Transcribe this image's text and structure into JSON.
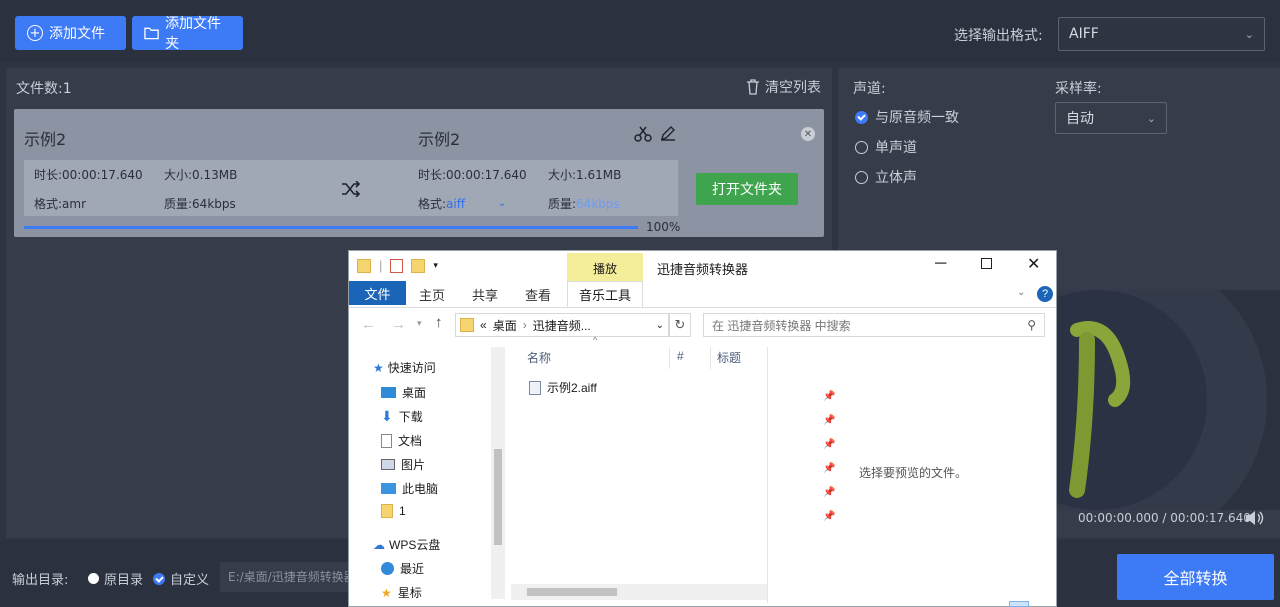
{
  "toolbar": {
    "add_file": "添加文件",
    "add_folder": "添加文件夹",
    "format_label": "选择输出格式:",
    "format_value": "AIFF"
  },
  "list": {
    "count_label": "文件数:",
    "count": "1",
    "clear": "清空列表"
  },
  "item": {
    "src_name": "示例2",
    "dst_name": "示例2",
    "src_duration": "时长:00:00:17.640",
    "src_size": "大小:0.13MB",
    "src_format": "格式:amr",
    "src_quality": "质量:64kbps",
    "dst_duration": "时长:00:00:17.640",
    "dst_size": "大小:1.61MB",
    "dst_format_label": "格式:",
    "dst_format": "aiff",
    "dst_quality_label": "质量:",
    "dst_quality": "64kbps",
    "open_folder": "打开文件夹",
    "progress_text": "100%",
    "progress": 1.0
  },
  "settings": {
    "channel_label": "声道:",
    "channel_options": [
      "与原音频一致",
      "单声道",
      "立体声"
    ],
    "samplerate_label": "采样率:",
    "samplerate_value": "自动"
  },
  "player": {
    "time": "00:00:00.000 / 00:00:17.640"
  },
  "output": {
    "label": "输出目录:",
    "opt_original": "原目录",
    "opt_custom": "自定义",
    "path": "E:/桌面/迅捷音频转换器",
    "convert_all": "全部转换"
  },
  "explorer": {
    "title": "迅捷音频转换器",
    "play_tab": "播放",
    "tabs": [
      "文件",
      "主页",
      "共享",
      "查看",
      "音乐工具"
    ],
    "breadcrumb_sep": "«",
    "breadcrumb": [
      "桌面",
      "迅捷音频..."
    ],
    "search_placeholder": "在 迅捷音频转换器 中搜索",
    "columns": [
      "名称",
      "#",
      "标题"
    ],
    "file": "示例2.aiff",
    "preview_text": "选择要预览的文件。",
    "nav": [
      {
        "label": "快速访问",
        "icon": "star-icon"
      },
      {
        "label": "桌面",
        "icon": "desktop-icon"
      },
      {
        "label": "下载",
        "icon": "download-icon"
      },
      {
        "label": "文档",
        "icon": "document-icon"
      },
      {
        "label": "图片",
        "icon": "picture-icon"
      },
      {
        "label": "此电脑",
        "icon": "computer-icon"
      },
      {
        "label": "1",
        "icon": "folder-icon"
      },
      {
        "label": "WPS云盘",
        "icon": "cloud-icon"
      },
      {
        "label": "最近",
        "icon": "recent-icon"
      },
      {
        "label": "星标",
        "icon": "star-icon"
      }
    ]
  },
  "colors": {
    "accent": "#3d7af5",
    "green": "#3ea44d",
    "bg": "#2e3442",
    "panel": "#363c4a"
  }
}
